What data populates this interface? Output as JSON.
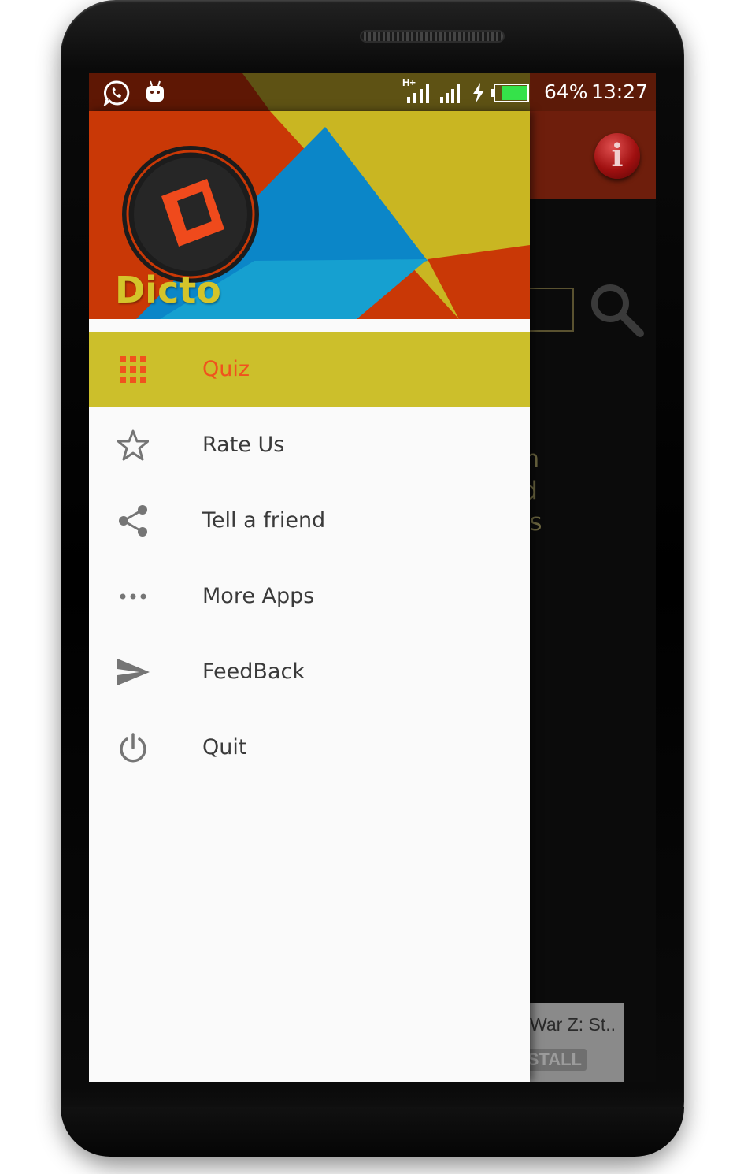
{
  "status_bar": {
    "network_label": "H+",
    "battery_percent": "64%",
    "time": "13:27",
    "icons": [
      "whatsapp-icon",
      "android-icon",
      "signal-icon",
      "signal-icon",
      "charging-icon",
      "battery-icon"
    ]
  },
  "background_app": {
    "info_label": "i",
    "text_lines": [
      "from",
      "ered",
      "ord's"
    ],
    "ad": {
      "title": "War Z: St..",
      "button": "STALL"
    }
  },
  "drawer": {
    "app_name": "Dicto",
    "items": [
      {
        "label": "Quiz",
        "icon": "grid-icon",
        "active": true
      },
      {
        "label": "Rate Us",
        "icon": "star-icon"
      },
      {
        "label": "Tell a friend",
        "icon": "share-icon"
      },
      {
        "label": "More Apps",
        "icon": "more-dots-icon"
      },
      {
        "label": "FeedBack",
        "icon": "send-icon"
      },
      {
        "label": "Quit",
        "icon": "power-icon"
      }
    ]
  },
  "colors": {
    "accent": "#ccbf2b",
    "active_text": "#f0521d",
    "toolbar": "#6e1e0c",
    "app_name": "#d4c42a"
  }
}
